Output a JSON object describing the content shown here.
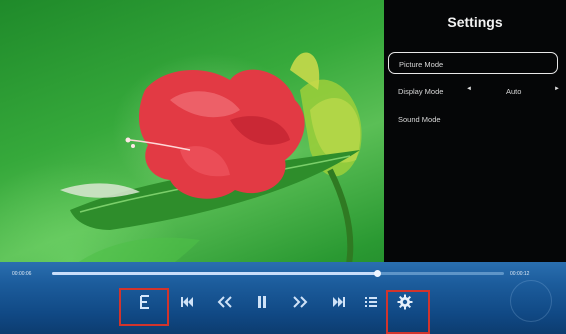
{
  "settings": {
    "title": "Settings",
    "items": [
      {
        "label": "Picture Mode",
        "selected": true
      },
      {
        "label": "Display Mode",
        "value": "Auto",
        "left_arrow": "◄",
        "right_arrow": "►"
      },
      {
        "label": "Sound Mode"
      }
    ]
  },
  "player": {
    "elapsed": "00:00:06",
    "total": "00:00:12",
    "progress_fraction": 0.72,
    "controls": [
      {
        "name": "subtitle-button",
        "icon": "subtitle-icon",
        "highlighted": true
      },
      {
        "name": "skip-previous-button",
        "icon": "skip-previous-icon"
      },
      {
        "name": "rewind-button",
        "icon": "rewind-icon"
      },
      {
        "name": "pause-button",
        "icon": "pause-icon"
      },
      {
        "name": "fast-forward-button",
        "icon": "fast-forward-icon"
      },
      {
        "name": "skip-next-button",
        "icon": "skip-next-icon"
      },
      {
        "name": "playlist-button",
        "icon": "playlist-icon"
      },
      {
        "name": "settings-button",
        "icon": "gear-icon",
        "highlighted": true
      }
    ]
  },
  "colors": {
    "bar": "#1c5c9c",
    "highlight": "#d2342c",
    "panel": "#050607"
  }
}
